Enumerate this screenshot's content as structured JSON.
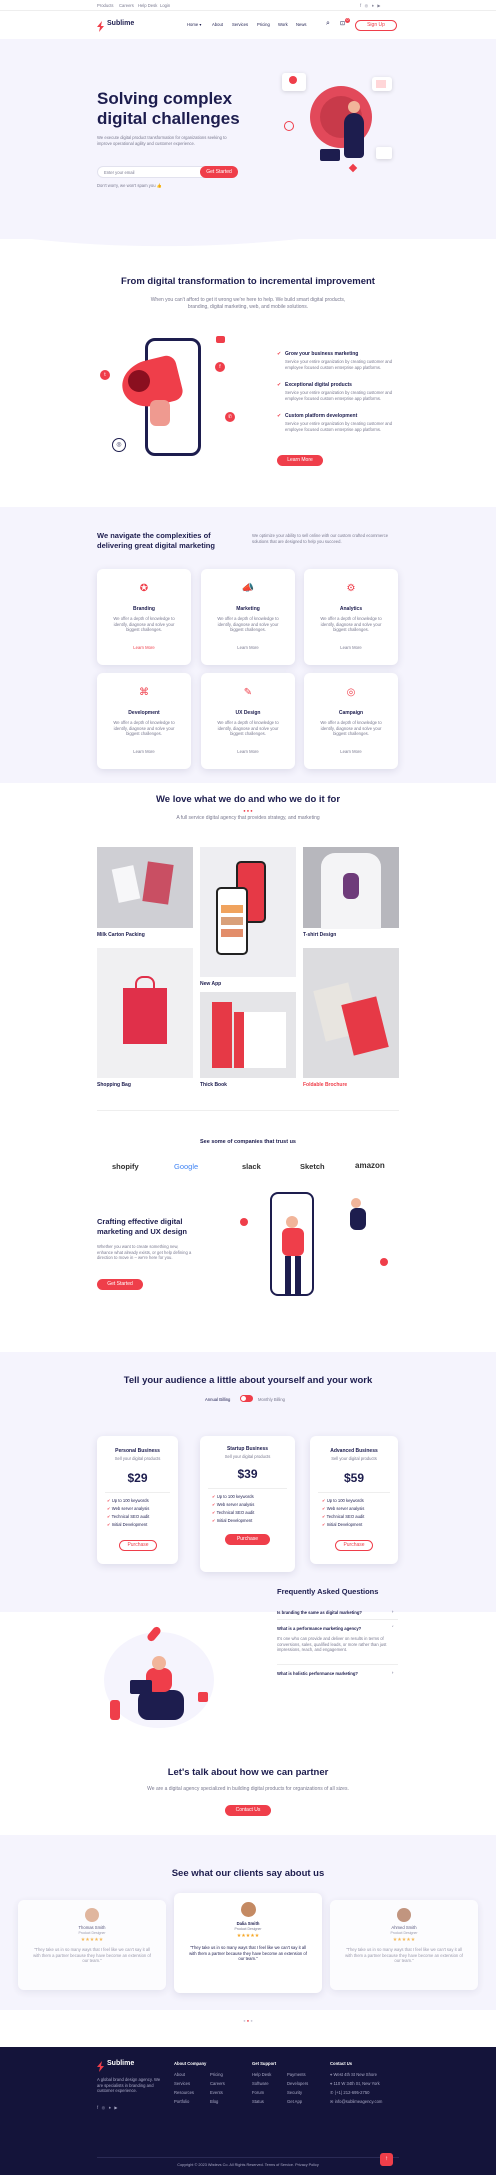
{
  "topbar": {
    "links": [
      "Products",
      "Careers",
      "Help Desk",
      "Login"
    ]
  },
  "header": {
    "logo": "Sublime",
    "nav": [
      "Home ▾",
      "About",
      "Services",
      "Pricing",
      "Work",
      "News"
    ],
    "signup": "Sign Up",
    "cart_count": "0"
  },
  "hero": {
    "title_line1": "Solving complex",
    "title_line2": "digital challenges",
    "desc": "We execute digital product transformation for organizations seeking to improve operational agility and customer experience.",
    "email_placeholder": "Enter your email",
    "cta": "Get Started",
    "note": "Don't worry, we won't spam you 👍"
  },
  "transform": {
    "title": "From digital transformation to incremental improvement",
    "desc": "When you can't afford to get it wrong we're here to help. We build smart digital products, branding, digital marketing, web, and mobile solutions.",
    "features": [
      {
        "title": "Grow your business marketing",
        "desc": "Service your entire organization by creating customer and employee focused custom enterprise app platforms."
      },
      {
        "title": "Exceptional digital products",
        "desc": "Service your entire organization by creating customer and employee focused custom enterprise app platforms."
      },
      {
        "title": "Custom platform development",
        "desc": "Service your entire organization by creating customer and employee focused custom enterprise app platforms."
      }
    ],
    "cta": "Learn More"
  },
  "services": {
    "title_line1": "We navigate the complexities of",
    "title_line2": "delivering great digital marketing",
    "desc": "We optimize your ability to sell online with our custom crafted ecommerce solutions that are designed to help you succeed.",
    "items": [
      {
        "name": "Branding",
        "desc": "We offer a depth of knowledge to identify, diagnose and solve your biggest challenges.",
        "link": "Learn More",
        "icon": "badge-icon"
      },
      {
        "name": "Marketing",
        "desc": "We offer a depth of knowledge to identify, diagnose and solve your biggest challenges.",
        "link": "Learn More",
        "icon": "megaphone-icon"
      },
      {
        "name": "Analytics",
        "desc": "We offer a depth of knowledge to identify, diagnose and solve your biggest challenges.",
        "link": "Learn More",
        "icon": "chart-icon"
      },
      {
        "name": "Development",
        "desc": "We offer a depth of knowledge to identify, diagnose and solve your biggest challenges.",
        "link": "Learn More",
        "icon": "code-icon"
      },
      {
        "name": "UX Design",
        "desc": "We offer a depth of knowledge to identify, diagnose and solve your biggest challenges.",
        "link": "Learn More",
        "icon": "pen-icon"
      },
      {
        "name": "Campaign",
        "desc": "We offer a depth of knowledge to identify, diagnose and solve your biggest challenges.",
        "link": "Learn More",
        "icon": "target-icon"
      }
    ]
  },
  "portfolio": {
    "title": "We love what we do and who we do it for",
    "desc": "A full service digital agency that provides strategy, and marketing",
    "items": [
      "Milk Carton Packing",
      "New App",
      "T-shirt Design",
      "Shopping Bag",
      "Thick Book",
      "Foldable Brochure"
    ]
  },
  "companies": {
    "title": "See some of companies that trust us",
    "logos": [
      "shopify",
      "Google",
      "slack",
      "Sketch",
      "amazon"
    ]
  },
  "crafting": {
    "title_line1": "Crafting effective digital",
    "title_line2": "marketing and UX design",
    "desc": "Whether you want to create something new, enhance what already exists, or get help defining a direction to move in – we're here for you.",
    "cta": "Get Started"
  },
  "pricing": {
    "title": "Tell your audience a little about yourself and your work",
    "toggle_left": "Annual Billing",
    "toggle_right": "Monthly Billing",
    "plans": [
      {
        "name": "Personal Business",
        "sub": "Sell your digital products",
        "price": "$29",
        "features": [
          "Up to 100 keywords",
          "Web server analysis",
          "Technical SEO audit",
          "Initial Development"
        ],
        "cta": "Purchase"
      },
      {
        "name": "Startup Business",
        "sub": "Sell your digital products",
        "price": "$39",
        "features": [
          "Up to 100 keywords",
          "Web server analysis",
          "Technical SEO audit",
          "Initial Development"
        ],
        "cta": "Purchase"
      },
      {
        "name": "Advanced Business",
        "sub": "Sell your digital products",
        "price": "$59",
        "features": [
          "Up to 100 keywords",
          "Web server analysis",
          "Technical SEO audit",
          "Initial Development"
        ],
        "cta": "Purchase"
      }
    ]
  },
  "faq": {
    "title": "Frequently Asked Questions",
    "items": [
      {
        "q": "Is branding the same as digital marketing?",
        "open": false
      },
      {
        "q": "What is a performance marketing agency?",
        "open": true,
        "a": "It's one who can provide and deliver on results in terms of conversions, sales, qualified leads, or more rather than just impressions, reach, and engagement."
      },
      {
        "q": "What is holistic performance marketing?",
        "open": false
      }
    ]
  },
  "partner": {
    "title": "Let's talk about how we can partner",
    "desc": "We are a digital agency specialized in building digital products for organizations of all sizes.",
    "cta": "Contact Us"
  },
  "testimonials": {
    "title": "See what our clients say about us",
    "items": [
      {
        "name": "Thomas Smith",
        "role": "Product Designer",
        "stars": "★★★★★",
        "quote": "\"They take us in so many ways that I feel like we can't say it all with them a partner because they have become an extension of our team.\""
      },
      {
        "name": "Dalia Smith",
        "role": "Product Designer",
        "stars": "★★★★★",
        "quote": "\"They take us in so many ways that I feel like we can't say it all with them a partner because they have become an extension of our team.\""
      },
      {
        "name": "Ahmed Smith",
        "role": "Product Designer",
        "stars": "★★★★★",
        "quote": "\"They take us in so many ways that I feel like we can't say it all with them a partner because they have become an extension of our team.\""
      }
    ]
  },
  "footer": {
    "logo": "Sublime",
    "desc": "A global brand design agency. We are specialists in branding and customer experience.",
    "cols": [
      {
        "title": "About Company",
        "links": [
          "About",
          "Services",
          "Resources",
          "Portfolio"
        ]
      },
      {
        "title": "",
        "links": [
          "Pricing",
          "Careers",
          "Events",
          "Blog"
        ]
      },
      {
        "title": "Get Support",
        "links": [
          "Help Desk",
          "Software",
          "Forum",
          "Status"
        ]
      },
      {
        "title": "",
        "links": [
          "Payments",
          "Developers",
          "Security",
          "Get App"
        ]
      },
      {
        "title": "Contact Us",
        "links": [
          "West 4th St New Shore",
          "110 W 34th St, New York",
          "(+1) 212-695-2750",
          "info@sublimeagency.com"
        ]
      }
    ],
    "copyright": "Copyright © 2023 Wbdevs Co. All Rights Reserved. Terms of Service. Privacy Policy"
  },
  "colors": {
    "accent": "#ef3e4a",
    "navy": "#1d1d4e",
    "footer_bg": "#14143a",
    "tint": "#f5f4fd"
  }
}
